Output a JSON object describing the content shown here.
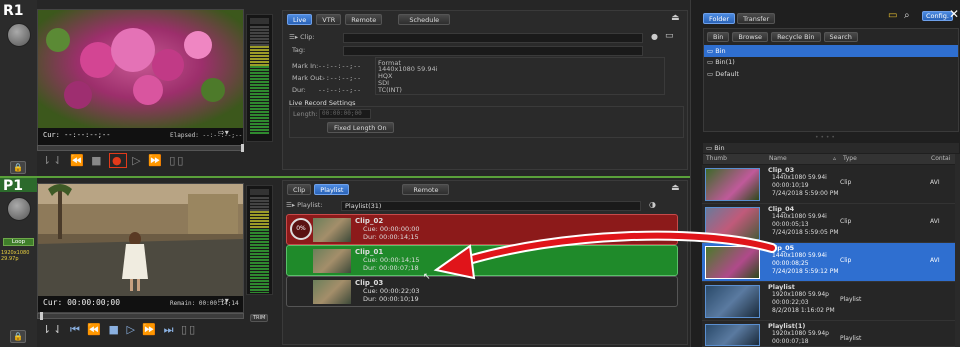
{
  "r1": {
    "label": "R1",
    "cur": "Cur: --:--:--;--",
    "elapsed": "Elapsed: --:--:--;--",
    "tabs": [
      "Live",
      "VTR",
      "Remote"
    ],
    "schedule": "Schedule",
    "clip_label": "Clip:",
    "tag_label": "Tag:",
    "mark_in": "Mark In:",
    "mark_out": "Mark Out:",
    "dur": "Dur:",
    "tc": "--:--:--;--",
    "format_label": "Format",
    "format_lines": [
      "1440x1080 59.94i",
      "HQX",
      "SDI",
      "TC(INT)"
    ],
    "live_record": "Live Record Settings",
    "length_label": "Length:",
    "length_value": "00:00:00;00",
    "fixed_length": "Fixed Length On"
  },
  "p1": {
    "label": "P1",
    "loop": "Loop",
    "rate": "1920x1080 29.97p",
    "cur": "Cur: 00:00:00;00",
    "remain": "Remain: 00:00:14;14",
    "trim": "TRIM",
    "tabs": [
      "Clip",
      "Playlist"
    ],
    "remote": "Remote",
    "playlist_label": "Playlist:",
    "playlist_value": "Playlist(31)",
    "progress": "0%",
    "clips": [
      {
        "name": "Clip_02",
        "cue": "Cue: 00:00:00;00",
        "dur": "Dur: 00:00:14;15"
      },
      {
        "name": "Clip_01",
        "cue": "Cue: 00:00:14;15",
        "dur": "Dur: 00:00:07;18"
      },
      {
        "name": "Clip_03",
        "cue": "Cue: 00:00:22;03",
        "dur": "Dur: 00:00:10;19"
      }
    ]
  },
  "bin": {
    "top_tabs": [
      "Folder",
      "Transfer"
    ],
    "config": "Config.",
    "sub_tabs": [
      "Bin",
      "Browse",
      "Recycle Bin",
      "Search"
    ],
    "folders": [
      "Bin",
      "Bin(1)",
      "Default"
    ],
    "path": "Bin",
    "columns": [
      "Thumb",
      "Name",
      "Type",
      "Contai"
    ],
    "rows": [
      {
        "name": "Clip_03",
        "l1": "1440x1080 59.94i",
        "l2": "00:00:10;19",
        "l3": "7/24/2018 5:59:00 PM",
        "type": "Clip",
        "cont": "AVI",
        "selected": false
      },
      {
        "name": "Clip_04",
        "l1": "1440x1080 59.94i",
        "l2": "00:00:05;13",
        "l3": "7/24/2018 5:59:05 PM",
        "type": "Clip",
        "cont": "AVI",
        "selected": false
      },
      {
        "name": "Clip_05",
        "l1": "1440x1080 59.94i",
        "l2": "00:00:08;25",
        "l3": "7/24/2018 5:59:12 PM",
        "type": "Clip",
        "cont": "AVI",
        "selected": true
      },
      {
        "name": "Playlist",
        "l1": "1920x1080 59.94p",
        "l2": "00:00:22;03",
        "l3": "8/2/2018 1:16:02 PM",
        "type": "Playlist",
        "cont": "",
        "selected": false
      },
      {
        "name": "Playlist(1)",
        "l1": "1920x1080 59.94p",
        "l2": "00:00:07;18",
        "l3": "8/2/2018 1:16:02 PM",
        "type": "Playlist",
        "cont": "",
        "selected": false
      }
    ]
  },
  "colors": {
    "accent": "#2f6fd0",
    "clip_red": "#8c1a1a",
    "clip_green": "#1f8a2a",
    "arrow": "#e0141a"
  }
}
